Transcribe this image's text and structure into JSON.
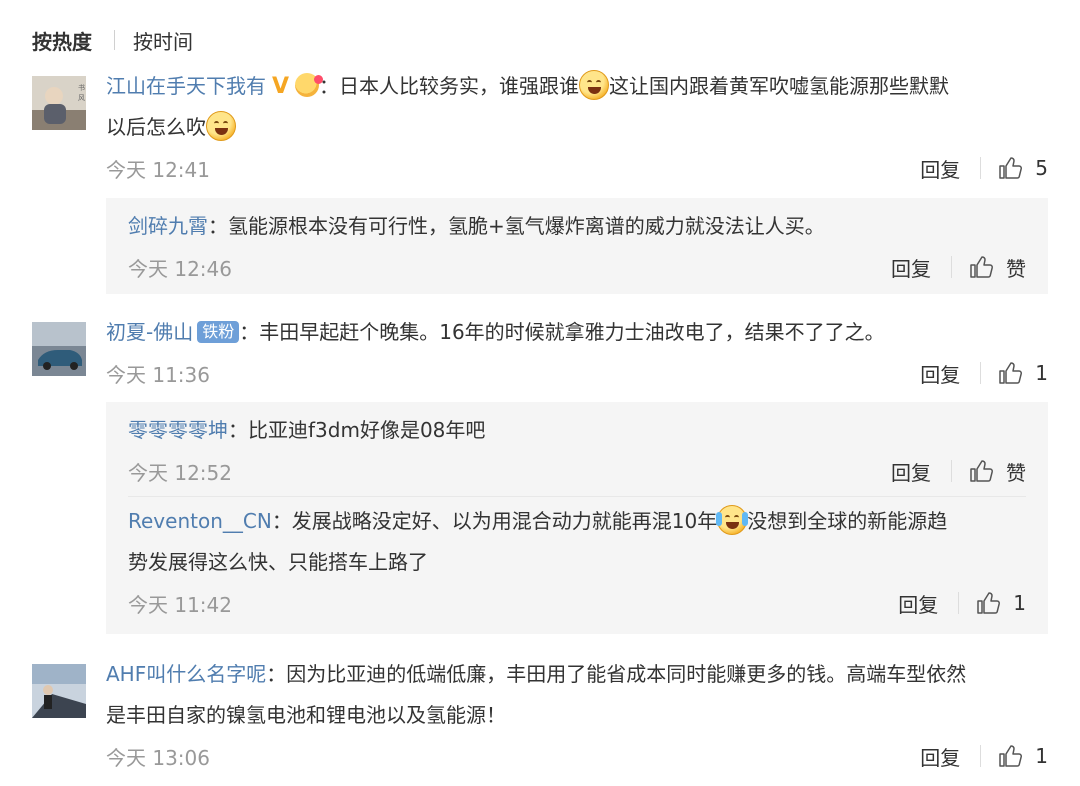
{
  "sort": {
    "hot": "按热度",
    "time": "按时间"
  },
  "comments": [
    {
      "user": "江山在手天下我有",
      "badge": "V",
      "text1": "：日本人比较务实，谁强跟谁",
      "text2": "这让国内跟着黄军吹嘘氢能源那些默默",
      "text3": "以后怎么吹",
      "time": "今天 12:41",
      "reply": "回复",
      "likes": "5"
    },
    {
      "user": "初夏-佛山",
      "fan_badge": "铁粉",
      "text": "：丰田早起赶个晚集。16年的时候就拿雅力士油改电了，结果不了了之。",
      "time": "今天 11:36",
      "reply": "回复",
      "likes": "1"
    },
    {
      "user": "AHF叫什么名字呢",
      "text1": "：因为比亚迪的低端低廉，丰田用了能省成本同时能赚更多的钱。高端车型依然",
      "text2": "是丰田自家的镍氢电池和锂电池以及氢能源！",
      "time": "今天 13:06",
      "reply": "回复",
      "likes": "1"
    }
  ],
  "subreplies": [
    {
      "user": "剑碎九霄",
      "text": "：氢能源根本没有可行性，氢脆+氢气爆炸离谱的威力就没法让人买。",
      "time": "今天 12:46",
      "reply": "回复",
      "likes": "赞"
    },
    {
      "user": "零零零零坤",
      "text": "：比亚迪f3dm好像是08年吧",
      "time": "今天 12:52",
      "reply": "回复",
      "likes": "赞"
    },
    {
      "user": "Reventon__CN",
      "text1": "：发展战略没定好、以为用混合动力就能再混10年",
      "text2": "没想到全球的新能源趋",
      "text3": "势发展得这么快、只能搭车上路了",
      "time": "今天 11:42",
      "reply": "回复",
      "likes": "1"
    }
  ],
  "colors": {
    "username": "#507daf",
    "time": "#999999",
    "subbox": "#f5f5f5",
    "badge_v": "#f5a623",
    "fan_badge": "#6e9fd8"
  }
}
